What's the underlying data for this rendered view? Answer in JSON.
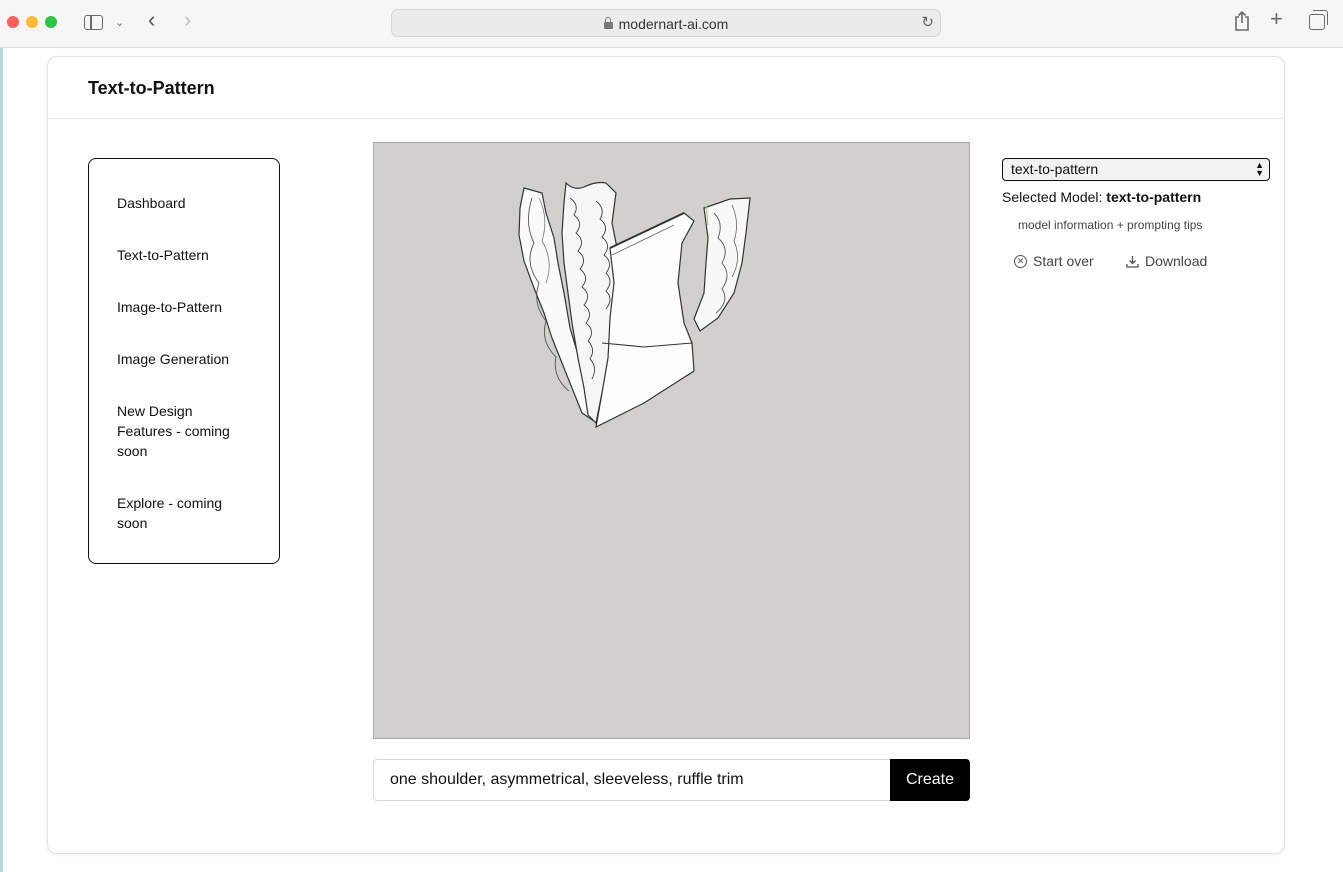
{
  "browser": {
    "url": "modernart-ai.com",
    "icons": [
      "sidebar-toggle-icon",
      "chevron-down-icon",
      "back-arrow-icon",
      "forward-arrow-icon",
      "lock-icon",
      "reload-icon",
      "share-icon",
      "plus-icon",
      "tabs-icon"
    ]
  },
  "app": {
    "title": "Text-to-Pattern"
  },
  "nav": {
    "items": [
      {
        "label": "Dashboard"
      },
      {
        "label": "Text-to-Pattern"
      },
      {
        "label": "Image-to-Pattern"
      },
      {
        "label": "Image Generation"
      },
      {
        "label": "New Design Features - coming soon"
      },
      {
        "label": "Explore - coming soon"
      }
    ]
  },
  "prompt": {
    "value": "one shoulder, asymmetrical, sleeveless, ruffle trim",
    "button_label": "Create"
  },
  "model": {
    "select_value": "text-to-pattern",
    "selected_label": "Selected Model:",
    "selected_value": "text-to-pattern",
    "info_link": "model information + prompting tips",
    "start_over_label": "Start over",
    "download_label": "Download"
  },
  "colors": {
    "canvas_bg": "#d1d0cd",
    "button_bg": "#000000",
    "border_dark": "#111111"
  }
}
